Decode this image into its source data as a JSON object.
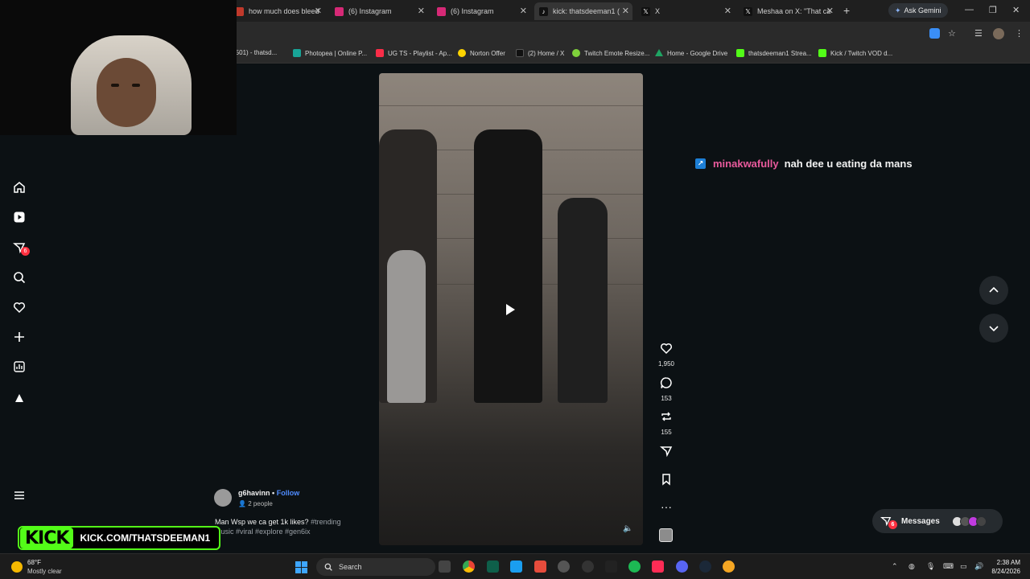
{
  "tabs": [
    {
      "label": "how much does bleed",
      "icon": "generic-icon",
      "color": "#c0392b"
    },
    {
      "label": "(6) Instagram",
      "icon": "instagram-icon",
      "color": "#d62976"
    },
    {
      "label": "(6) Instagram",
      "icon": "instagram-icon",
      "color": "#d62976"
    },
    {
      "label": "kick: thatsdeeman1 (",
      "icon": "tiktok-icon",
      "color": "#111111"
    },
    {
      "label": "X",
      "icon": "x-icon",
      "color": "#111111"
    },
    {
      "label": "Meshaa on X: \"That ca",
      "icon": "x-icon",
      "color": "#111111"
    }
  ],
  "gemini_label": "Ask Gemini",
  "bookmarks": [
    {
      "label": "(501) - thatsd...",
      "color": "#ff0000"
    },
    {
      "label": "Photopea | Online P...",
      "color": "#18a497"
    },
    {
      "label": "UG TS - Playlist - Ap...",
      "color": "#fa2d48"
    },
    {
      "label": "Norton Offer",
      "color": "#ffd400"
    },
    {
      "label": "(2) Home / X",
      "color": "#111111"
    },
    {
      "label": "Twitch Emote Resize...",
      "color": "#7fd13b"
    },
    {
      "label": "Home - Google Drive",
      "color": "#1fa463"
    },
    {
      "label": "thatsdeeman1 Strea...",
      "color": "#53fc18"
    },
    {
      "label": "Kick / Twitch VOD d...",
      "color": "#53fc18"
    }
  ],
  "rail": {
    "notification_badge": "6"
  },
  "actions": {
    "likes": "1,950",
    "comments": "153",
    "reposts": "155"
  },
  "chat": {
    "user": "minakwafully",
    "message": "nah dee u eating da mans",
    "user_color": "#e85a9c"
  },
  "post": {
    "username": "g6havinn",
    "separator": "•",
    "follow_label": "Follow",
    "audience": "2 people",
    "caption": "Man Wsp we ca get 1k likes?",
    "hashtags": "#trending music #viral #explore #gen6ix"
  },
  "messages": {
    "label": "Messages",
    "badge": "6"
  },
  "kick_overlay": {
    "logo": "KICK",
    "url": "KICK.COM/THATSDEEMAN1",
    "accent": "#53fc18"
  },
  "taskbar": {
    "weather_temp": "68°F",
    "weather_desc": "Mostly clear",
    "search_placeholder": "Search",
    "time": "2:38 AM",
    "date": "8/24/2026"
  }
}
